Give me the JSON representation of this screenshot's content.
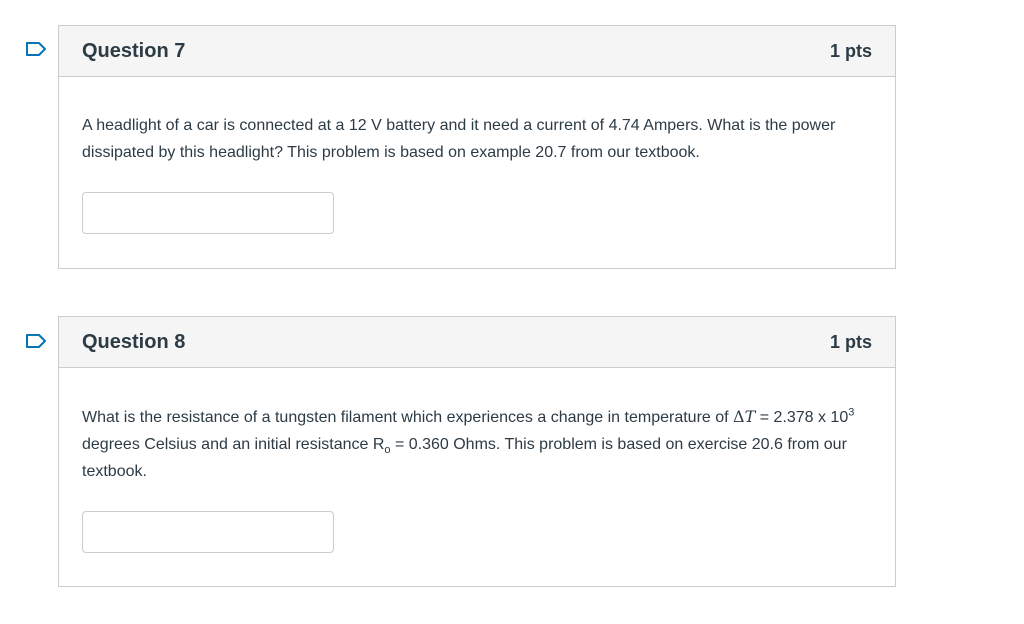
{
  "questions": [
    {
      "title": "Question 7",
      "points": "1 pts",
      "text": "A headlight of a car is connected at a 12 V battery and it need a current of 4.74 Ampers.  What is the power dissipated by this headlight?  This problem is based on example 20.7 from our textbook.",
      "answer_value": "",
      "flag_icon": "flag-icon"
    },
    {
      "title": "Question 8",
      "points": "1 pts",
      "text_parts": {
        "part1": "What is the resistance of a tungsten filament which experiences a change in temperature of ",
        "math_delta": "Δ",
        "math_T": "T",
        "part2": " = 2.378 x 10",
        "exp": "3",
        "part3": " degrees Celsius and an initial resistance R",
        "sub": "o",
        "part4": " = 0.360 Ohms.  This problem is based on exercise 20.6 from our textbook."
      },
      "answer_value": "",
      "flag_icon": "flag-icon"
    }
  ],
  "colors": {
    "header_bg": "#f5f5f5",
    "border": "#c7cdd1",
    "text": "#2d3b45",
    "flag": "#0374b5"
  }
}
